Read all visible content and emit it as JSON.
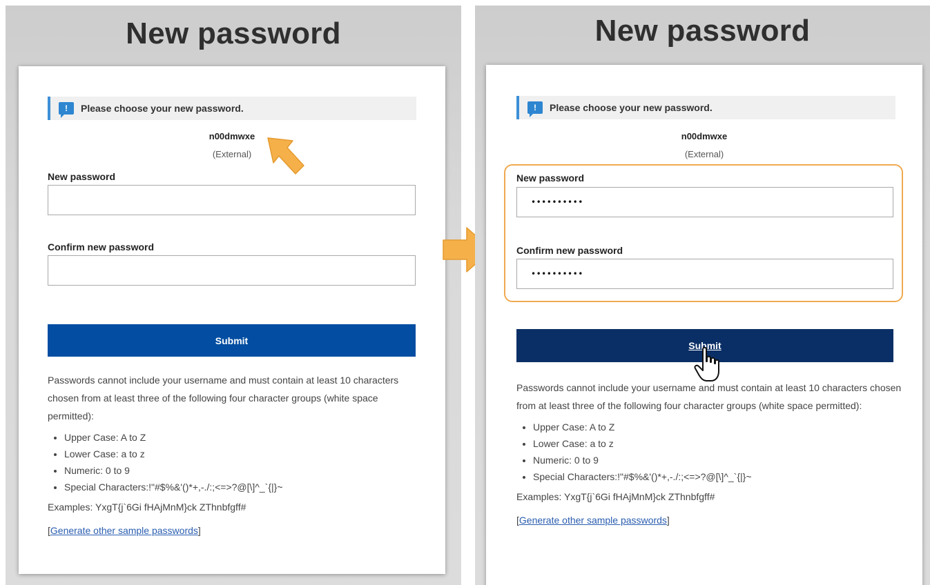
{
  "left": {
    "title": "New password",
    "notice": "Please choose your new password.",
    "username": "n00dmwxe",
    "user_type": "(External)",
    "new_password_label": "New password",
    "new_password_value": "",
    "confirm_password_label": "Confirm new password",
    "confirm_password_value": "",
    "submit_label": "Submit",
    "rules_text": "Passwords cannot include your username and must contain at least 10 characters chosen from at least three of the following four character groups (white space permitted):",
    "rules": [
      "Upper Case: A to Z",
      "Lower Case: a to z",
      "Numeric: 0 to 9",
      "Special Characters:!\"#$%&'()*+,-./:;<=>?@[\\]^_`{|}~"
    ],
    "examples": "Examples: YxgT{j`6Gi fHAjMnM}ck ZThnbfgff#",
    "generate_link": "Generate other sample passwords",
    "bracket_open": "[",
    "bracket_close": "]"
  },
  "right": {
    "title": "New password",
    "notice": "Please choose your new password.",
    "username": "n00dmwxe",
    "user_type": "(External)",
    "new_password_label": "New password",
    "new_password_value": "••••••••••",
    "confirm_password_label": "Confirm new password",
    "confirm_password_value": "••••••••••",
    "submit_label": "Submit",
    "rules_text": "Passwords cannot include your username and must contain at least 10 characters chosen from at least three of the following four character groups (white space permitted):",
    "rules": [
      "Upper Case: A to Z",
      "Lower Case: a to z",
      "Numeric: 0 to 9",
      "Special Characters:!\"#$%&'()*+,-./:;<=>?@[\\]^_`{|}~"
    ],
    "examples": "Examples: YxgT{j`6Gi fHAjMnM}ck ZThnbfgff#",
    "generate_link": "Generate other sample passwords",
    "bracket_open": "[",
    "bracket_close": "]"
  },
  "colors": {
    "arrow": "#f5b04a",
    "focus_outline": "#f0a950",
    "submit_left": "#034ea2",
    "submit_right": "#0a2f66",
    "info_icon": "#2e86d1"
  },
  "icons": {
    "callout_arrow": "arrow-pointer-icon",
    "step_arrow": "arrow-right-icon",
    "cursor": "hand-pointer-icon",
    "notice": "info-icon"
  }
}
